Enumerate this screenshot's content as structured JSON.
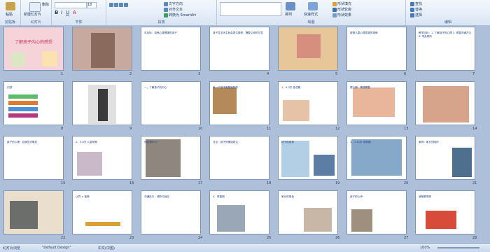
{
  "ribbon": {
    "clipboard": {
      "label": "剪贴板",
      "paste": "粘贴"
    },
    "slides": {
      "label": "幻灯片",
      "new_slide": "新建幻灯片",
      "delete": "删除"
    },
    "font": {
      "label": "字体",
      "font_size": "18"
    },
    "paragraph": {
      "label": "段落",
      "text_direction": "文字方向",
      "align_text": "对齐文本",
      "smartart": "转换为 SmartArt"
    },
    "drawing": {
      "label": "绘图",
      "arrange": "排列",
      "quick_styles": "快速样式",
      "shape_fill": "形状填充",
      "shape_outline": "形状轮廓",
      "shape_effects": "形状效果"
    },
    "editing": {
      "label": "编辑",
      "find": "查找",
      "replace": "替换",
      "select": "选择"
    }
  },
  "slides": [
    {
      "num": "1",
      "caption": "了解孩子内心的感受"
    },
    {
      "num": "2",
      "caption": ""
    },
    {
      "num": "3",
      "caption": "总目标：培养心理健康的孩子"
    },
    {
      "num": "4",
      "caption": "孩子并非天生就会表达感受，需要父母的引导"
    },
    {
      "num": "5",
      "caption": ""
    },
    {
      "num": "6",
      "caption": "按照儿童心理发展的规律"
    },
    {
      "num": "7",
      "caption": "教学目标：1. 了解孩子的心理 2. 掌握沟通方法 3. 学会倾听"
    },
    {
      "num": "8",
      "caption": "内容"
    },
    {
      "num": "9",
      "caption": ""
    },
    {
      "num": "10",
      "caption": "一、了解孩子的内心"
    },
    {
      "num": "11",
      "caption": "每一个孩子都是独特的"
    },
    {
      "num": "12",
      "caption": "1、0-3岁 依恋期"
    },
    {
      "num": "13",
      "caption": "婴儿期：情感需要"
    },
    {
      "num": "14",
      "caption": ""
    },
    {
      "num": "15",
      "caption": "孩子的心理：自我意识萌发"
    },
    {
      "num": "16",
      "caption": "2、3-6岁 儿童早期"
    },
    {
      "num": "17",
      "caption": "你在想什么？"
    },
    {
      "num": "18",
      "caption": "讨论：孩子的情绪表达"
    },
    {
      "num": "19",
      "caption": "孩子的表现"
    },
    {
      "num": "20",
      "caption": "3、7-12岁 学龄期"
    },
    {
      "num": "21",
      "caption": "案例：家长的陪伴"
    },
    {
      "num": "22",
      "caption": ""
    },
    {
      "num": "23",
      "caption": "认同 ≠ 接受"
    },
    {
      "num": "24",
      "caption": "沟通技巧：倾听与回应"
    },
    {
      "num": "25",
      "caption": "4、青春期"
    },
    {
      "num": "26",
      "caption": "家长的角色"
    },
    {
      "num": "27",
      "caption": "孩子的心声"
    },
    {
      "num": "28",
      "caption": "我爸是李刚"
    }
  ],
  "status": {
    "slide_view": "幻灯片浏览",
    "theme": "\"Default Design\"",
    "language": "中文(中国)",
    "zoom": "100%"
  }
}
